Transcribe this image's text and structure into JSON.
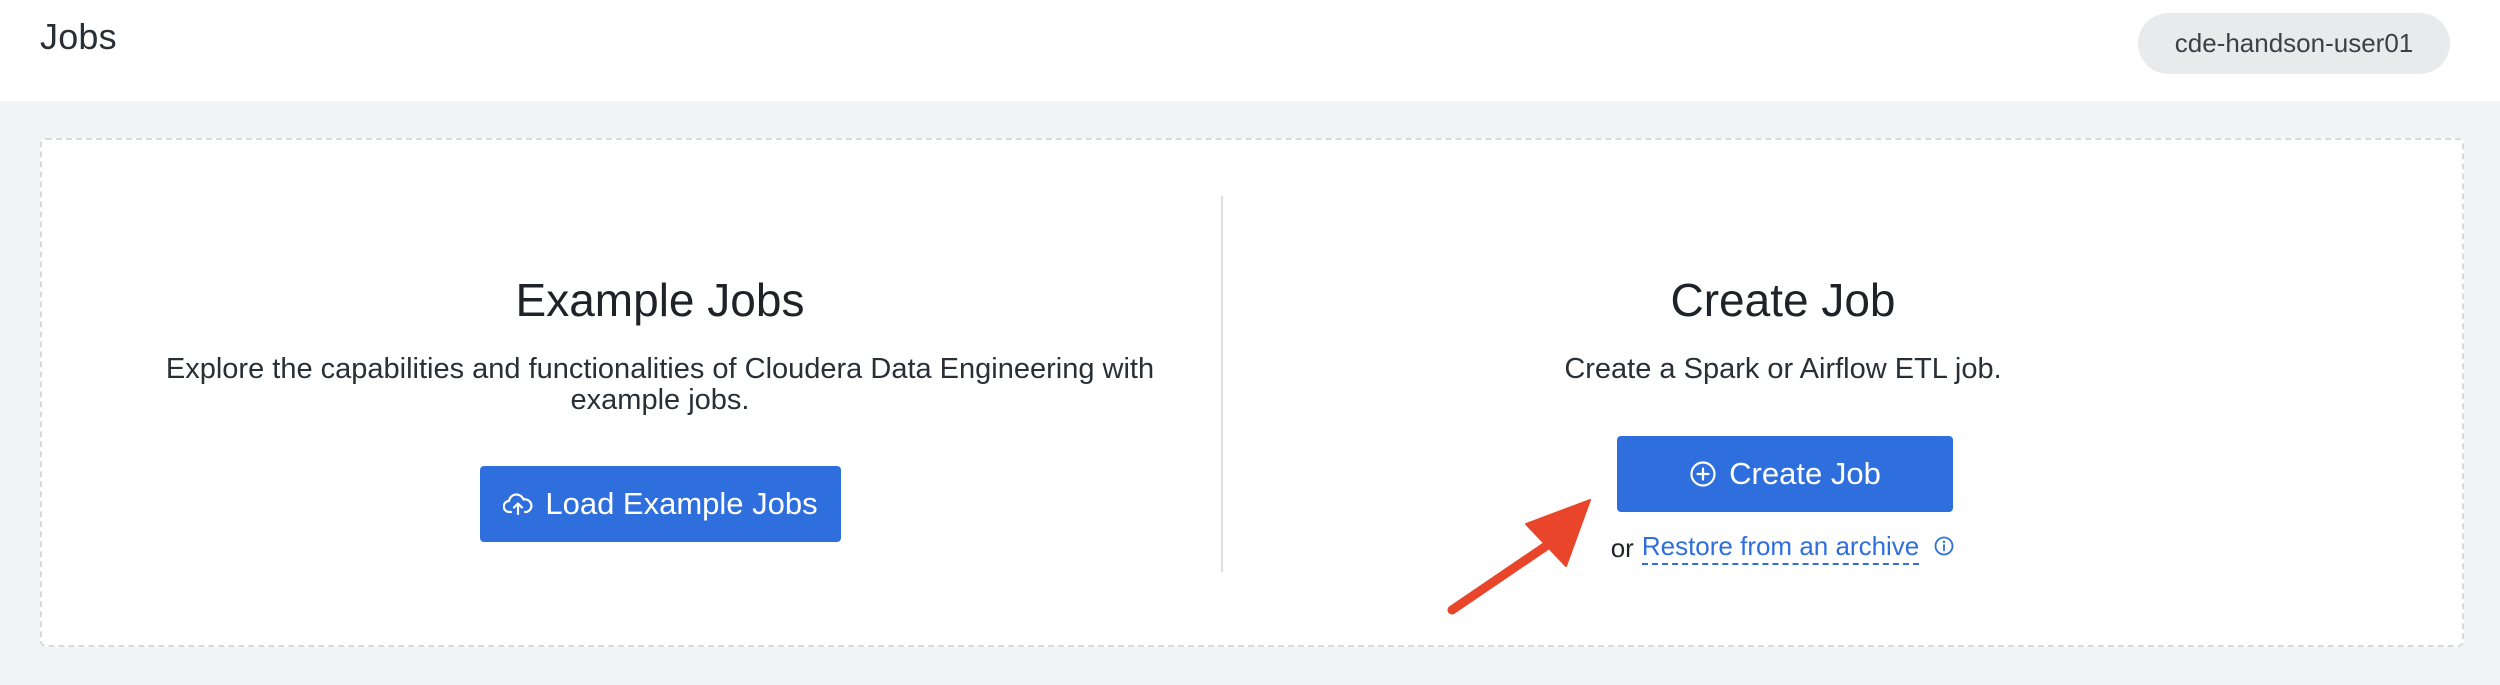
{
  "header": {
    "title": "Jobs",
    "user_chip": "cde-handson-user01"
  },
  "example_jobs": {
    "heading": "Example Jobs",
    "description": "Explore the capabilities and functionalities of Cloudera Data Engineering with example jobs.",
    "button_label": "Load Example Jobs",
    "button_icon": "cloud-upload-icon"
  },
  "create_job": {
    "heading": "Create Job",
    "description": "Create a Spark or Airflow ETL job.",
    "button_label": "Create Job",
    "button_icon": "plus-circle-icon",
    "or_text": "or",
    "restore_link": "Restore from an archive",
    "info_icon": "info-icon"
  },
  "colors": {
    "primary": "#2f6fdd",
    "annotation_arrow": "#e8452a"
  }
}
